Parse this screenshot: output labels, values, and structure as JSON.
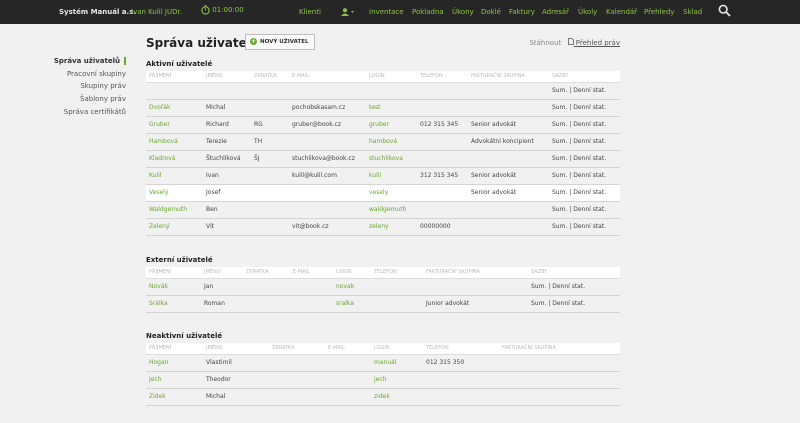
{
  "topbar": {
    "app_title": "Systém Manuál a.s.",
    "user": "Ivan Kulil JUDr.",
    "timer": "01:00:00",
    "nav": [
      "Klienti",
      "Inventace",
      "Pokladna",
      "Úkony",
      "Doklé",
      "Faktury",
      "Adresář",
      "Úkoly",
      "Kalendář",
      "Přehledy",
      "Sklad"
    ]
  },
  "sidebar": {
    "items": [
      {
        "label": "Správa uživatelů",
        "active": true
      },
      {
        "label": "Pracovní skupiny",
        "active": false
      },
      {
        "label": "Skupiny práv",
        "active": false
      },
      {
        "label": "Šablony práv",
        "active": false
      },
      {
        "label": "Správa certifikátů",
        "active": false
      }
    ]
  },
  "page": {
    "title": "Správa uživatelů",
    "new_user_label": "NOVÝ UŽIVATEL",
    "download_label": "Stáhnout",
    "download_link": "Přehled práv"
  },
  "active": {
    "title": "Aktivní uživatelé",
    "columns": [
      "PŘÍJMENÍ",
      "JMÉNO",
      "ZKRATKA",
      "E-MAIL",
      "LOGIN",
      "TELEFON",
      "FAKTURAČNÍ SKUPINA",
      "SAZBY"
    ],
    "rows": [
      [
        "",
        "",
        "",
        "",
        "",
        "",
        "",
        "Sum. | Denní stat."
      ],
      [
        "Dvořák",
        "Michal",
        "",
        "pochobskasam.cz",
        "test",
        "",
        "",
        "Sum. | Denní stat."
      ],
      [
        "Gruber",
        "Richard",
        "RG",
        "gruber@book.cz",
        "gruber",
        "012 315 345",
        "Senior advokát",
        "Sum. | Denní stat."
      ],
      [
        "Hambová",
        "Terezie",
        "TH",
        "",
        "hambová",
        "",
        "Advokátní koncipient",
        "Sum. | Denní stat."
      ],
      [
        "Kladrová",
        "Štuchlíková",
        "ŠJ",
        "stuchlikova@book.cz",
        "stuchlikova",
        "",
        "",
        "Sum. | Denní stat."
      ],
      [
        "Kulil",
        "Ivan",
        "",
        "kulil@kulil.com",
        "kulil",
        "312 315 345",
        "Senior advokát",
        "Sum. | Denní stat."
      ],
      [
        "Veselý",
        "Josef",
        "",
        "",
        "vesely",
        "",
        "Senior advokát",
        "Sum. | Denní stat."
      ],
      [
        "Waldgemuth",
        "Ben",
        "",
        "",
        "waldgemuth",
        "",
        "",
        "Sum. | Denní stat."
      ],
      [
        "Zelený",
        "Vít",
        "",
        "vit@book.cz",
        "zeleny",
        "00000000",
        "",
        "Sum. | Denní stat."
      ]
    ]
  },
  "external": {
    "title": "Externí uživatelé",
    "columns": [
      "PŘÍJMENÍ",
      "JMÉNO",
      "ZKRATKA",
      "E-MAIL",
      "LOGIN",
      "TELEFON",
      "FAKTURAČNÍ SKUPINA",
      "SAZBY"
    ],
    "rows": [
      [
        "Novák",
        "Jan",
        "",
        "",
        "novak",
        "",
        "",
        "Sum. | Denní stat."
      ],
      [
        "Srálka",
        "Roman",
        "",
        "",
        "sralka",
        "",
        "Junior advokát",
        "Sum. | Denní stat."
      ]
    ]
  },
  "inactive": {
    "title": "Neaktivní uživatelé",
    "columns": [
      "PŘÍJMENÍ",
      "JMÉNO",
      "ZKRATKA",
      "E-MAIL",
      "LOGIN",
      "TELEFON",
      "FAKTURAČNÍ SKUPINA"
    ],
    "rows": [
      [
        "Hogan",
        "Vlastimil",
        "",
        "",
        "manuál",
        "012 315 350",
        ""
      ],
      [
        "Jech",
        "Theodor",
        "",
        "",
        "jech",
        "",
        ""
      ],
      [
        "Zídek",
        "Michal",
        "",
        "",
        "zidek",
        "",
        ""
      ]
    ]
  },
  "colors": {
    "topbar": "#262626",
    "accent": "#8cc63f",
    "accent_dark": "#6aa82e",
    "background": "#f1f1f1"
  }
}
